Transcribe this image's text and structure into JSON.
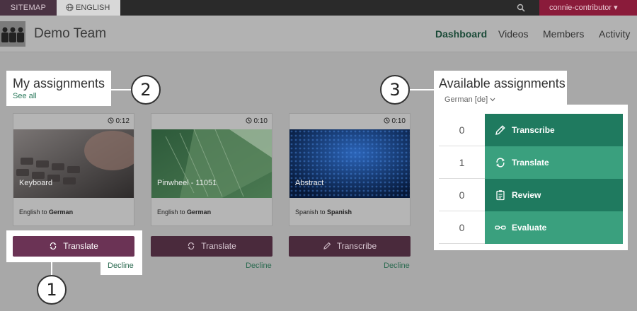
{
  "topbar": {
    "sitemap": "SITEMAP",
    "language": "ENGLISH",
    "user": "connie-contributor ▾"
  },
  "header": {
    "team_name": "Demo Team",
    "nav": [
      "Dashboard",
      "Videos",
      "Members",
      "Activity"
    ],
    "active_nav": "Dashboard"
  },
  "my_assignments": {
    "title": "My assignments",
    "see_all": "See all",
    "cards": [
      {
        "title": "Keyboard",
        "duration": "0:12",
        "from": "English to",
        "to": "German",
        "action": "Translate",
        "decline": "Decline"
      },
      {
        "title": "Pinwheel - 11051",
        "duration": "0:10",
        "from": "English to",
        "to": "German",
        "action": "Translate",
        "decline": "Decline"
      },
      {
        "title": "Abstract",
        "duration": "0:10",
        "from": "Spanish to",
        "to": "Spanish",
        "action": "Transcribe",
        "decline": "Decline"
      }
    ]
  },
  "available_assignments": {
    "title": "Available assignments",
    "language_select": "German [de]",
    "rows": [
      {
        "count": "0",
        "label": "Transcribe",
        "icon": "pencil-icon"
      },
      {
        "count": "1",
        "label": "Translate",
        "icon": "translate-icon"
      },
      {
        "count": "0",
        "label": "Review",
        "icon": "clipboard-icon"
      },
      {
        "count": "0",
        "label": "Evaluate",
        "icon": "glasses-icon"
      }
    ]
  },
  "callouts": [
    "1",
    "2",
    "3"
  ],
  "colors": {
    "brand_purple": "#6b3355",
    "brand_green": "#1f7a5f",
    "user_red": "#8a1b3a"
  }
}
